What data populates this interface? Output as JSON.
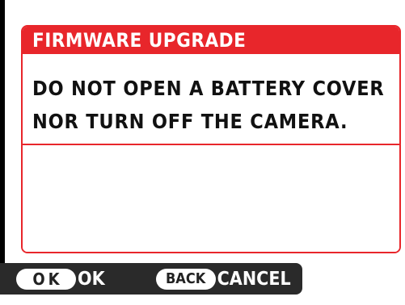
{
  "dialog": {
    "title": "FIRMWARE UPGRADE",
    "message_line1": "DO NOT OPEN A BATTERY COVER",
    "message_line2": "NOR TURN OFF THE CAMERA."
  },
  "footer": {
    "ok_key": "OK",
    "ok_label": "OK",
    "back_key": "BACK",
    "cancel_label": "CANCEL"
  },
  "colors": {
    "accent": "#e8262b",
    "bar": "#2a2a2a"
  }
}
